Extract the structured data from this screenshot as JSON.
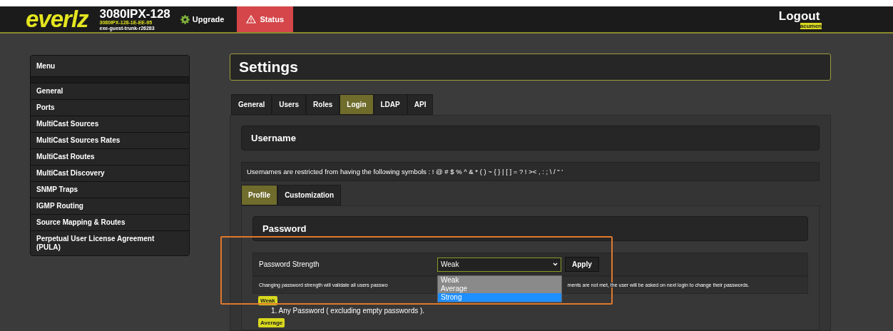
{
  "header": {
    "logo": "everlz",
    "model": "3080IPX-128",
    "serial": "3080IPX-128-1E-EE-95",
    "build": "exe-guest-trunk-r26283",
    "upgrade": "Upgrade",
    "status": "Status",
    "logout": "Logout",
    "user": "acumen"
  },
  "menu": {
    "title": "Menu",
    "items": [
      {
        "label": "General"
      },
      {
        "label": "Ports"
      },
      {
        "label": "MultiCast Sources"
      },
      {
        "label": "MultiCast Sources Rates"
      },
      {
        "label": "MultiCast Routes"
      },
      {
        "label": "MultiCast Discovery"
      },
      {
        "label": "SNMP Traps"
      },
      {
        "label": "IGMP Routing"
      },
      {
        "label": "Source Mapping & Routes"
      },
      {
        "label": "Perpetual User License Agreement (PULA)"
      }
    ]
  },
  "title": "Settings",
  "tabs": [
    {
      "label": "General",
      "selected": false
    },
    {
      "label": "Users",
      "selected": false
    },
    {
      "label": "Roles",
      "selected": false
    },
    {
      "label": "Login",
      "selected": true
    },
    {
      "label": "LDAP",
      "selected": false
    },
    {
      "label": "API",
      "selected": false
    }
  ],
  "username": {
    "heading": "Username",
    "note": "Usernames are restricted from having the following symbols : ! @ # $ % ^ & * ( ) ~ { } | [ ] = ? ! >< , : ; \\ / \" '"
  },
  "subtabs": [
    {
      "label": "Profile",
      "selected": true
    },
    {
      "label": "Customization",
      "selected": false
    }
  ],
  "password": {
    "heading": "Password",
    "label": "Password Strength",
    "value": "Weak",
    "options": [
      {
        "label": "Weak",
        "highlighted": false
      },
      {
        "label": "Average",
        "highlighted": false
      },
      {
        "label": "Strong",
        "highlighted": true
      }
    ],
    "apply": "Apply",
    "description_start": "Changing password strength will validate all users passwo",
    "description_end": "ments are not met, the user will be asked on next login to change their passwords.",
    "levels": [
      {
        "badge": "Weak",
        "rules": [
          "1. Any Password ( excluding empty passwords )."
        ]
      },
      {
        "badge": "Average"
      }
    ]
  }
}
